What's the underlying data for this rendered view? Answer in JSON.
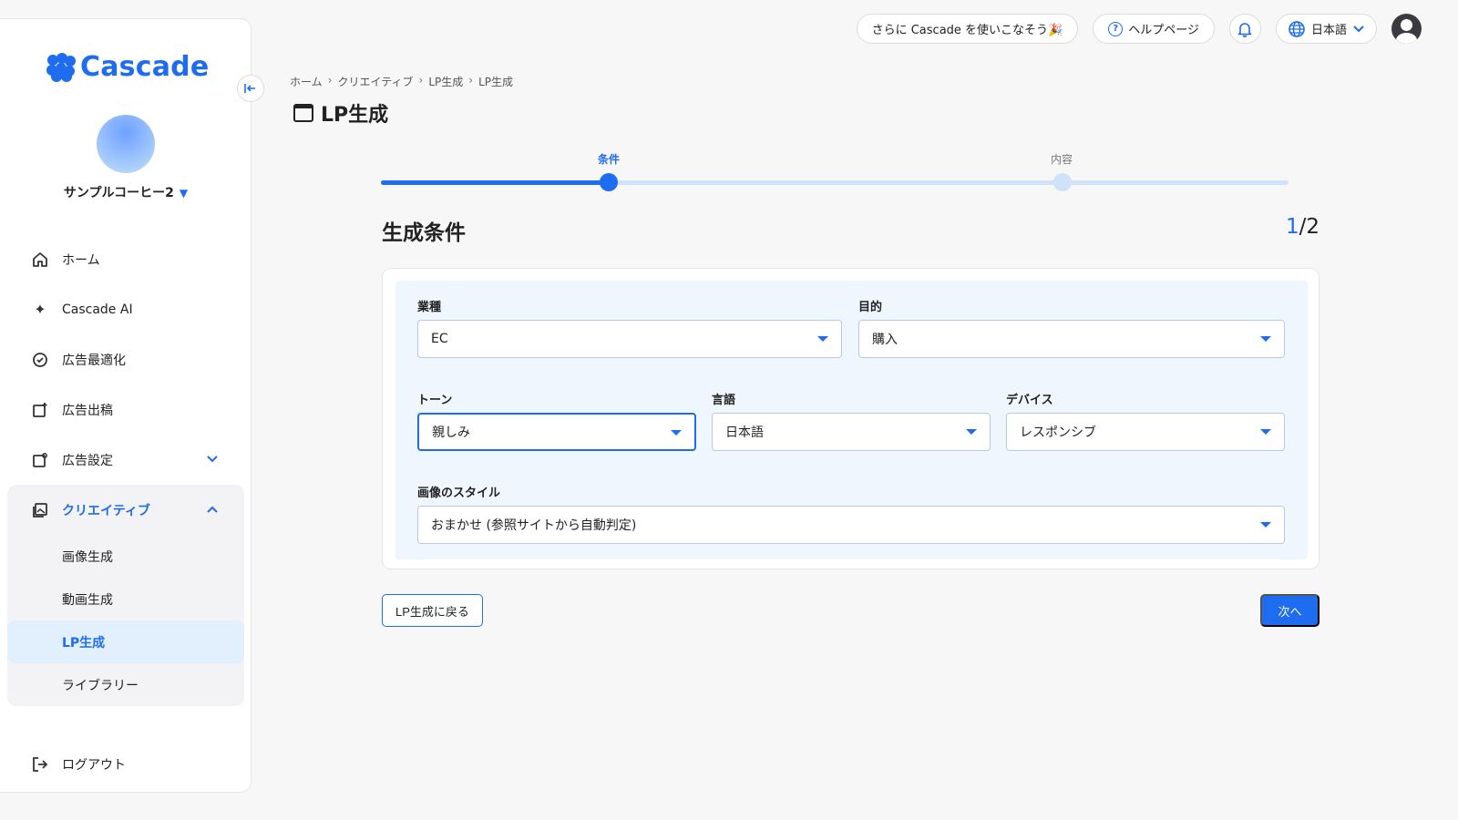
{
  "sidebar": {
    "logo_text": "Cascade",
    "account_name": "サンプルコーヒー2",
    "items": [
      {
        "label": "ホーム"
      },
      {
        "label": "Cascade AI"
      },
      {
        "label": "広告最適化"
      },
      {
        "label": "広告出稿"
      },
      {
        "label": "広告設定"
      },
      {
        "label": "クリエイティブ"
      }
    ],
    "creative_sub": [
      {
        "label": "画像生成"
      },
      {
        "label": "動画生成"
      },
      {
        "label": "LP生成"
      },
      {
        "label": "ライブラリー"
      }
    ],
    "logout_label": "ログアウト"
  },
  "topbar": {
    "promo_label": "さらに Cascade を使いこなそう🎉",
    "help_label": "ヘルプページ",
    "language_label": "日本語"
  },
  "breadcrumb": [
    "ホーム",
    "クリエイティブ",
    "LP生成",
    "LP生成"
  ],
  "page_title": "LP生成",
  "stepper": {
    "steps": [
      {
        "label": "条件"
      },
      {
        "label": "内容"
      }
    ],
    "current": 1
  },
  "section": {
    "title": "生成条件",
    "step_current": "1",
    "step_total": "/2"
  },
  "form": {
    "industry": {
      "label": "業種",
      "value": "EC"
    },
    "purpose": {
      "label": "目的",
      "value": "購入"
    },
    "tone": {
      "label": "トーン",
      "value": "親しみ"
    },
    "language": {
      "label": "言語",
      "value": "日本語"
    },
    "device": {
      "label": "デバイス",
      "value": "レスポンシブ"
    },
    "image_style": {
      "label": "画像のスタイル",
      "value": "おまかせ (参照サイトから自動判定)"
    }
  },
  "buttons": {
    "back_label": "LP生成に戻る",
    "next_label": "次へ"
  },
  "colors": {
    "accent": "#1e6cf0",
    "active_bg": "#e2effc",
    "form_bg": "#eff6fd"
  }
}
